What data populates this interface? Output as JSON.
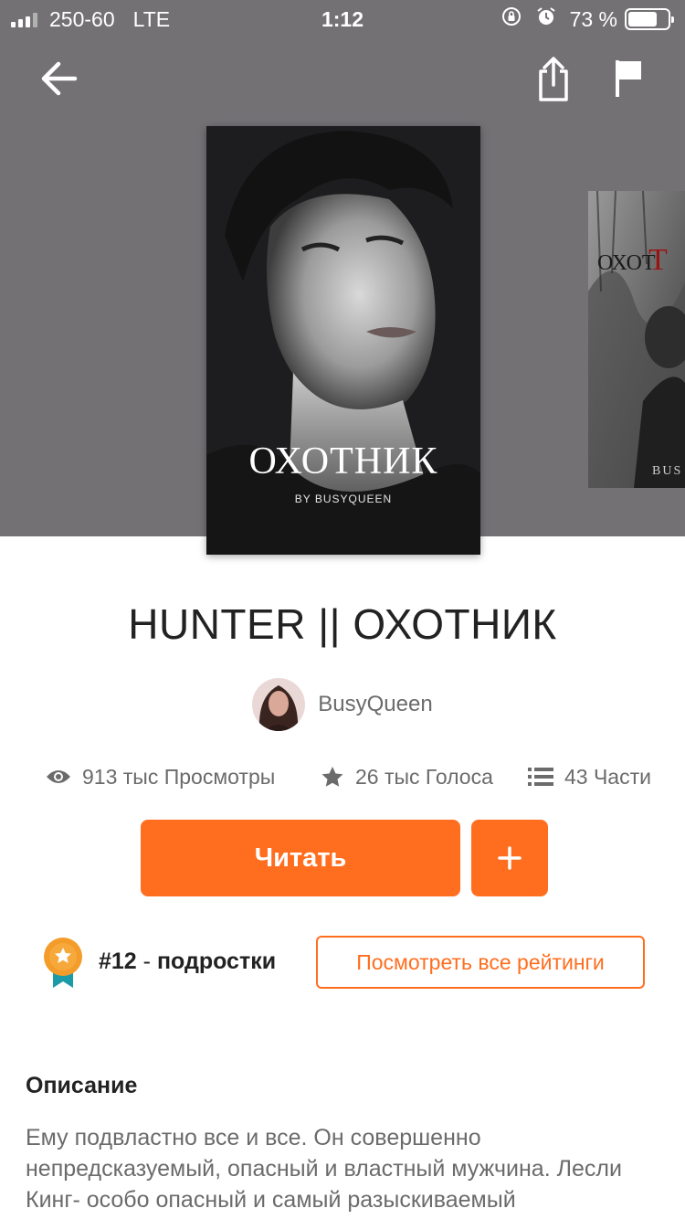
{
  "status_bar": {
    "carrier": "250-60",
    "network": "LTE",
    "time": "1:12",
    "battery_percent": "73 %",
    "battery_level": 0.73
  },
  "nav": {
    "icons": [
      "back-arrow-icon",
      "share-icon",
      "flag-icon"
    ]
  },
  "cover": {
    "title_text": "ОХОТНИК",
    "byline": "BY BUSYQUEEN",
    "next_title_text": "ОХОТ"
  },
  "book": {
    "title": "HUNTER || ОХОТНИК",
    "author": "BusyQueen"
  },
  "stats": {
    "views": "913 тыс Просмотры",
    "votes": "26 тыс Голоса",
    "parts": "43 Части"
  },
  "actions": {
    "read_label": "Читать",
    "add_label": "+"
  },
  "ranking": {
    "rank": "#12",
    "separator": " - ",
    "category": "подростки",
    "all_ratings_label": "Посмотреть все рейтинги"
  },
  "description": {
    "heading": "Описание",
    "text": "Ему подвластно все и все. Он совершенно непредсказуемый, опасный и властный мужчина. Лесли Кинг- особо опасный и самый разыскиваемый"
  },
  "colors": {
    "accent": "#ff6e1f",
    "hero_bg": "#737174",
    "muted_text": "#6b6b6b"
  }
}
